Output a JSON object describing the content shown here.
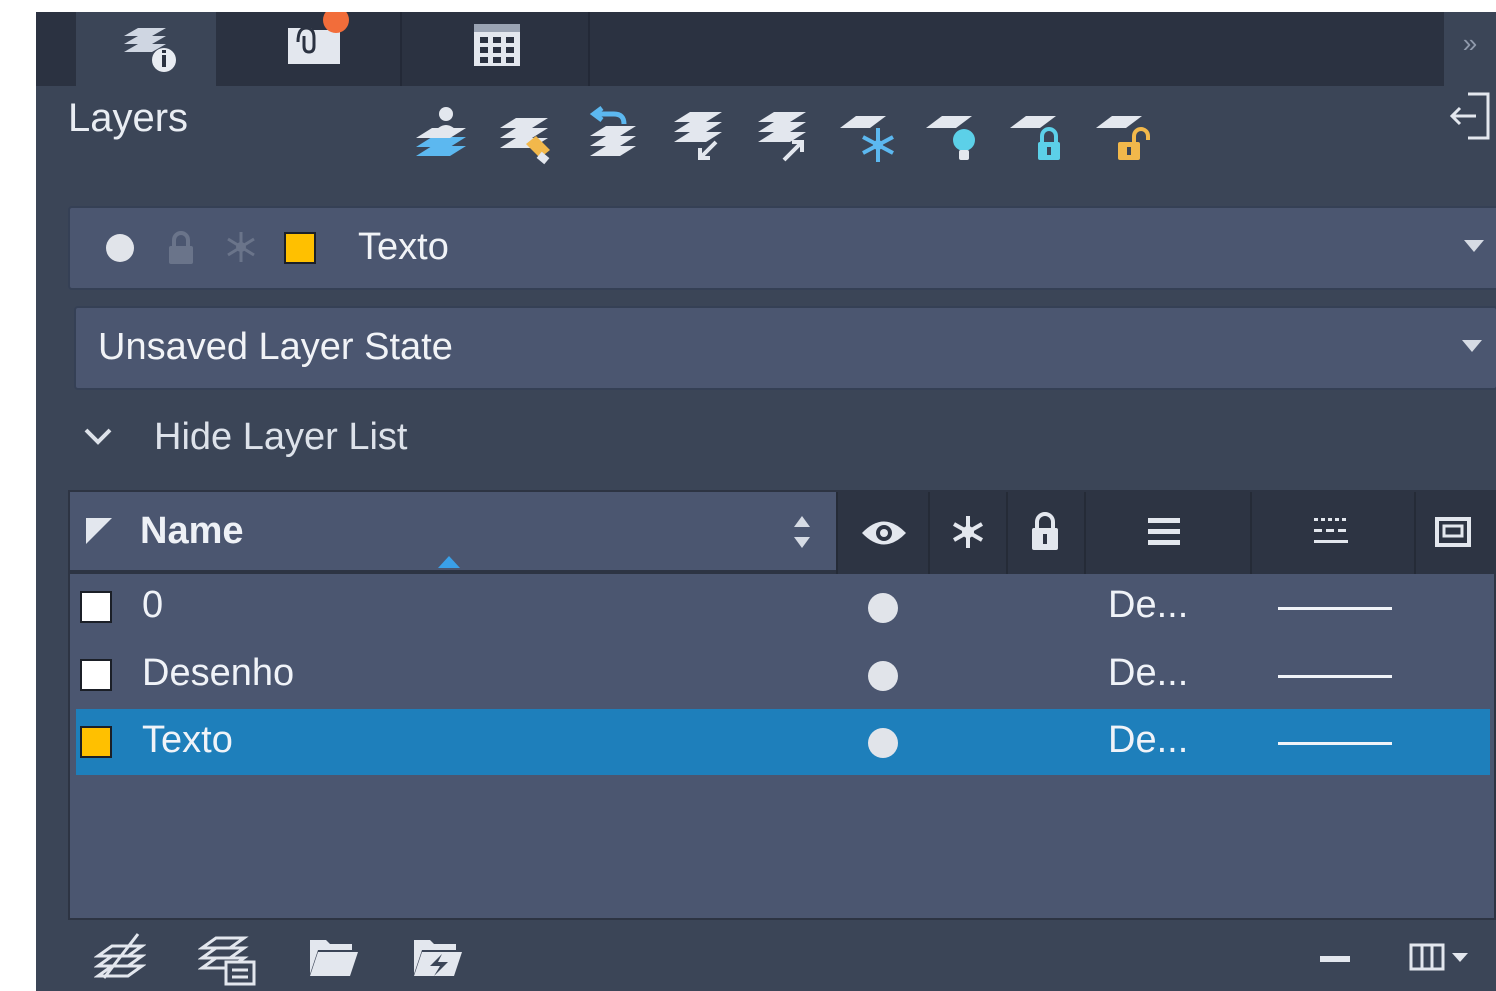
{
  "tabs": [
    {
      "name": "layers-properties-tab",
      "icon": "layer-info-icon",
      "active": true
    },
    {
      "name": "external-references-tab",
      "icon": "xref-attach-icon",
      "badge": true
    },
    {
      "name": "grid-view-tab",
      "icon": "grid-icon"
    }
  ],
  "panel": {
    "title": "Layers",
    "overflow_label": "»"
  },
  "toolbar": {
    "tools": [
      "new-layer-icon",
      "match-layer-icon",
      "previous-layer-icon",
      "layer-isolate-icon",
      "layer-unisolate-icon",
      "freeze-layer-icon",
      "turn-off-layer-icon",
      "lock-layer-icon",
      "unlock-layer-icon"
    ]
  },
  "current_layer": {
    "name": "Texto",
    "color": "#ffc000"
  },
  "layer_state": {
    "value": "Unsaved Layer State"
  },
  "layer_list_toggle": {
    "label": "Hide Layer List"
  },
  "table": {
    "header_name": "Name",
    "rows": [
      {
        "name": "0",
        "color": "#ffffff",
        "on": true,
        "lineweight": "De...",
        "selected": false
      },
      {
        "name": "Desenho",
        "color": "#ffffff",
        "on": true,
        "lineweight": "De...",
        "selected": false
      },
      {
        "name": "Texto",
        "color": "#ffc000",
        "on": true,
        "lineweight": "De...",
        "selected": true
      }
    ]
  },
  "colors": {
    "panel_bg": "#3b4557",
    "tab_bg": "#2b3241",
    "field_bg": "#4b5670",
    "selection": "#1e7fbb",
    "accent_blue": "#5cb8f0",
    "badge_orange": "#f26d3a",
    "lock_yellow": "#f2b84b"
  }
}
